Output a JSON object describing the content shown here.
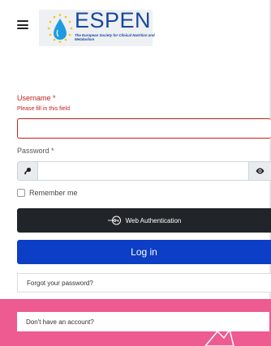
{
  "header": {
    "logo_word": "ESPEN",
    "logo_subtitle": "The European Society for Clinical Nutrition and Metabolism"
  },
  "form": {
    "username_label": "Username *",
    "username_error": "Please fill in this field",
    "username_value": "",
    "password_label": "Password *",
    "password_value": "",
    "remember_label": "Remember me",
    "webauthn_label": "Web Authentication",
    "login_label": "Log in",
    "forgot_label": "Forgot your password?",
    "signup_label": "Don't have an account?"
  },
  "colors": {
    "brand_blue": "#17479d",
    "error_red": "#c02020",
    "login_button": "#0d3ec6",
    "webauthn_button": "#212529",
    "pink_band": "#ed5b90"
  },
  "icons": [
    "hamburger-menu-icon",
    "espen-drop-logo",
    "key-icon",
    "eye-icon",
    "webauthn-key-icon"
  ]
}
